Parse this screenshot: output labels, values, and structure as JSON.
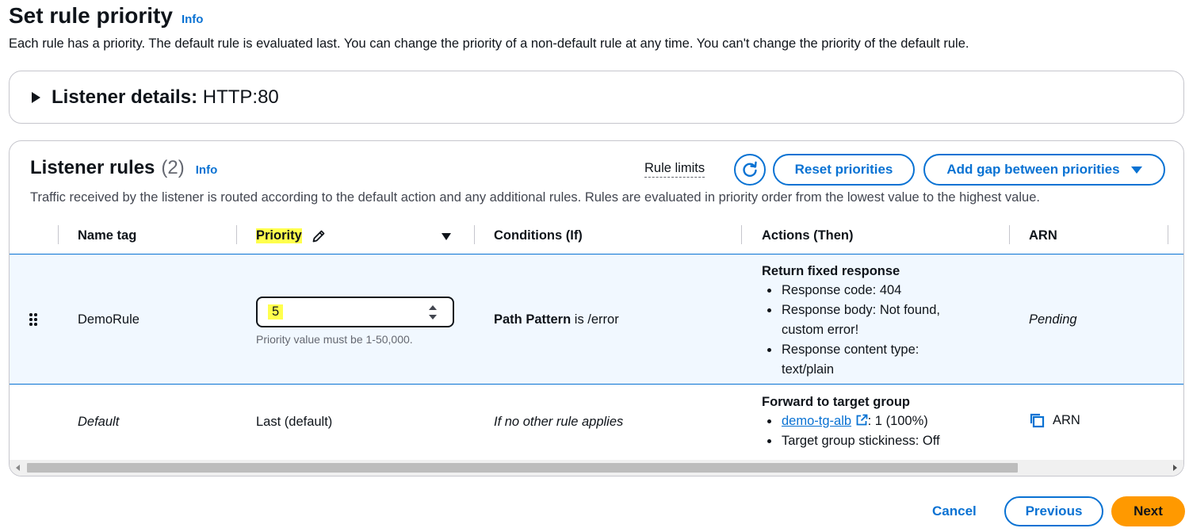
{
  "header": {
    "title": "Set rule priority",
    "info": "Info",
    "description": "Each rule has a priority. The default rule is evaluated last. You can change the priority of a non-default rule at any time. You can't change the priority of the default rule."
  },
  "listener": {
    "label": "Listener details:",
    "value": "HTTP:80"
  },
  "rules": {
    "title": "Listener rules",
    "count": "(2)",
    "info": "Info",
    "description": "Traffic received by the listener is routed according to the default action and any additional rules. Rules are evaluated in priority order from the lowest value to the highest value.",
    "rule_limits": "Rule limits",
    "reset_priorities": "Reset priorities",
    "add_gap": "Add gap between priorities",
    "columns": [
      "Name tag",
      "Priority",
      "Conditions (If)",
      "Actions (Then)",
      "ARN"
    ],
    "rows": [
      {
        "name": "DemoRule",
        "priority_value": "5",
        "priority_hint": "Priority value must be 1-50,000.",
        "condition_key": "Path Pattern",
        "condition_rest": " is /error",
        "action_title": "Return fixed response",
        "action_items": [
          "Response code: 404",
          "Response body: Not found,",
          "custom error!",
          "Response content type:",
          "text/plain"
        ],
        "arn": "Pending"
      },
      {
        "name": "Default",
        "priority": "Last (default)",
        "condition": "If no other rule applies",
        "action_title": "Forward to target group",
        "target_link": "demo-tg-alb",
        "target_weight": ": 1 (100%)",
        "stickiness": "Target group stickiness: Off",
        "arn": "ARN"
      }
    ],
    "scroll_position": 0.0,
    "scroll_visible_fraction": 0.87
  },
  "footer": {
    "cancel": "Cancel",
    "previous": "Previous",
    "next": "Next"
  },
  "colors": {
    "accent": "#0972d3",
    "primary_button": "#ff9900",
    "highlight": "#ffff4d",
    "selected_row": "#f1f8ff"
  },
  "icons": [
    "refresh-icon",
    "edit-pencil-icon",
    "sort-caret-icon",
    "drag-handle-icon",
    "external-link-icon",
    "copy-icon",
    "caret-right-icon",
    "caret-down-icon"
  ]
}
